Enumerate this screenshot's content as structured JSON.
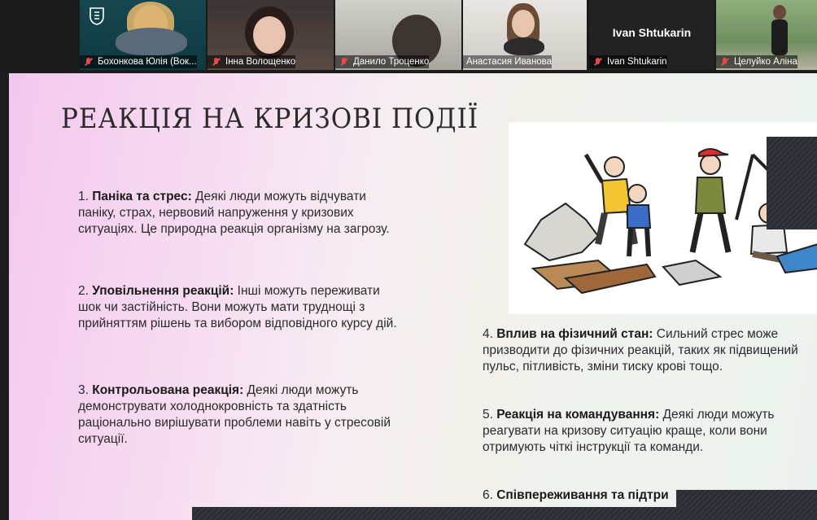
{
  "participants": [
    {
      "name": "Бохонкова Юлія (Вок..."
    },
    {
      "name": "Інна Волощенко"
    },
    {
      "name": "Данило Троценко"
    },
    {
      "name": "Анастасия Иванова"
    },
    {
      "name": "Ivan Shtukarin",
      "display_name": "Ivan Shtukarin"
    },
    {
      "name": "Целуйко Аліна"
    }
  ],
  "slide": {
    "title": "РЕАКЦІЯ НА КРИЗОВІ ПОДІЇ",
    "points": [
      {
        "label": "Паніка та стрес:",
        "prefix": "1. ",
        "text": " Деякі люди можуть відчувати паніку, страх, нервовий напруження у кризових ситуаціях. Це природна реакція організму на загрозу."
      },
      {
        "label": "Уповільнення реакцій:",
        "prefix": "2. ",
        "text": " Інші можуть переживати шок чи застійність. Вони можуть мати труднощі з прийняттям рішень та вибором відповідного курсу дій."
      },
      {
        "label": "Контрольована реакція:",
        "prefix": "3. ",
        "text": " Деякі люди можуть демонструвати холоднокровність та здатність раціонально вирішувати проблеми навіть у стресовій ситуації."
      },
      {
        "label": "Вплив на фізичний стан:",
        "prefix": "4. ",
        "text": " Сильний стрес може призводити до фізичних реакцій, таких як підвищений пульс, пітливість, зміни тиску крові тощо."
      },
      {
        "label": "Реакція на командування:",
        "prefix": "5. ",
        "text": " Деякі люди можуть реагувати на кризову ситуацію краще, коли вони отримують чіткі інструкції та команди."
      },
      {
        "label": "Співпереживання та підтри",
        "prefix": "6. ",
        "text": ""
      }
    ]
  },
  "colors": {
    "mic_muted": "#e5484d",
    "active_speaker": "#b9d25e"
  }
}
